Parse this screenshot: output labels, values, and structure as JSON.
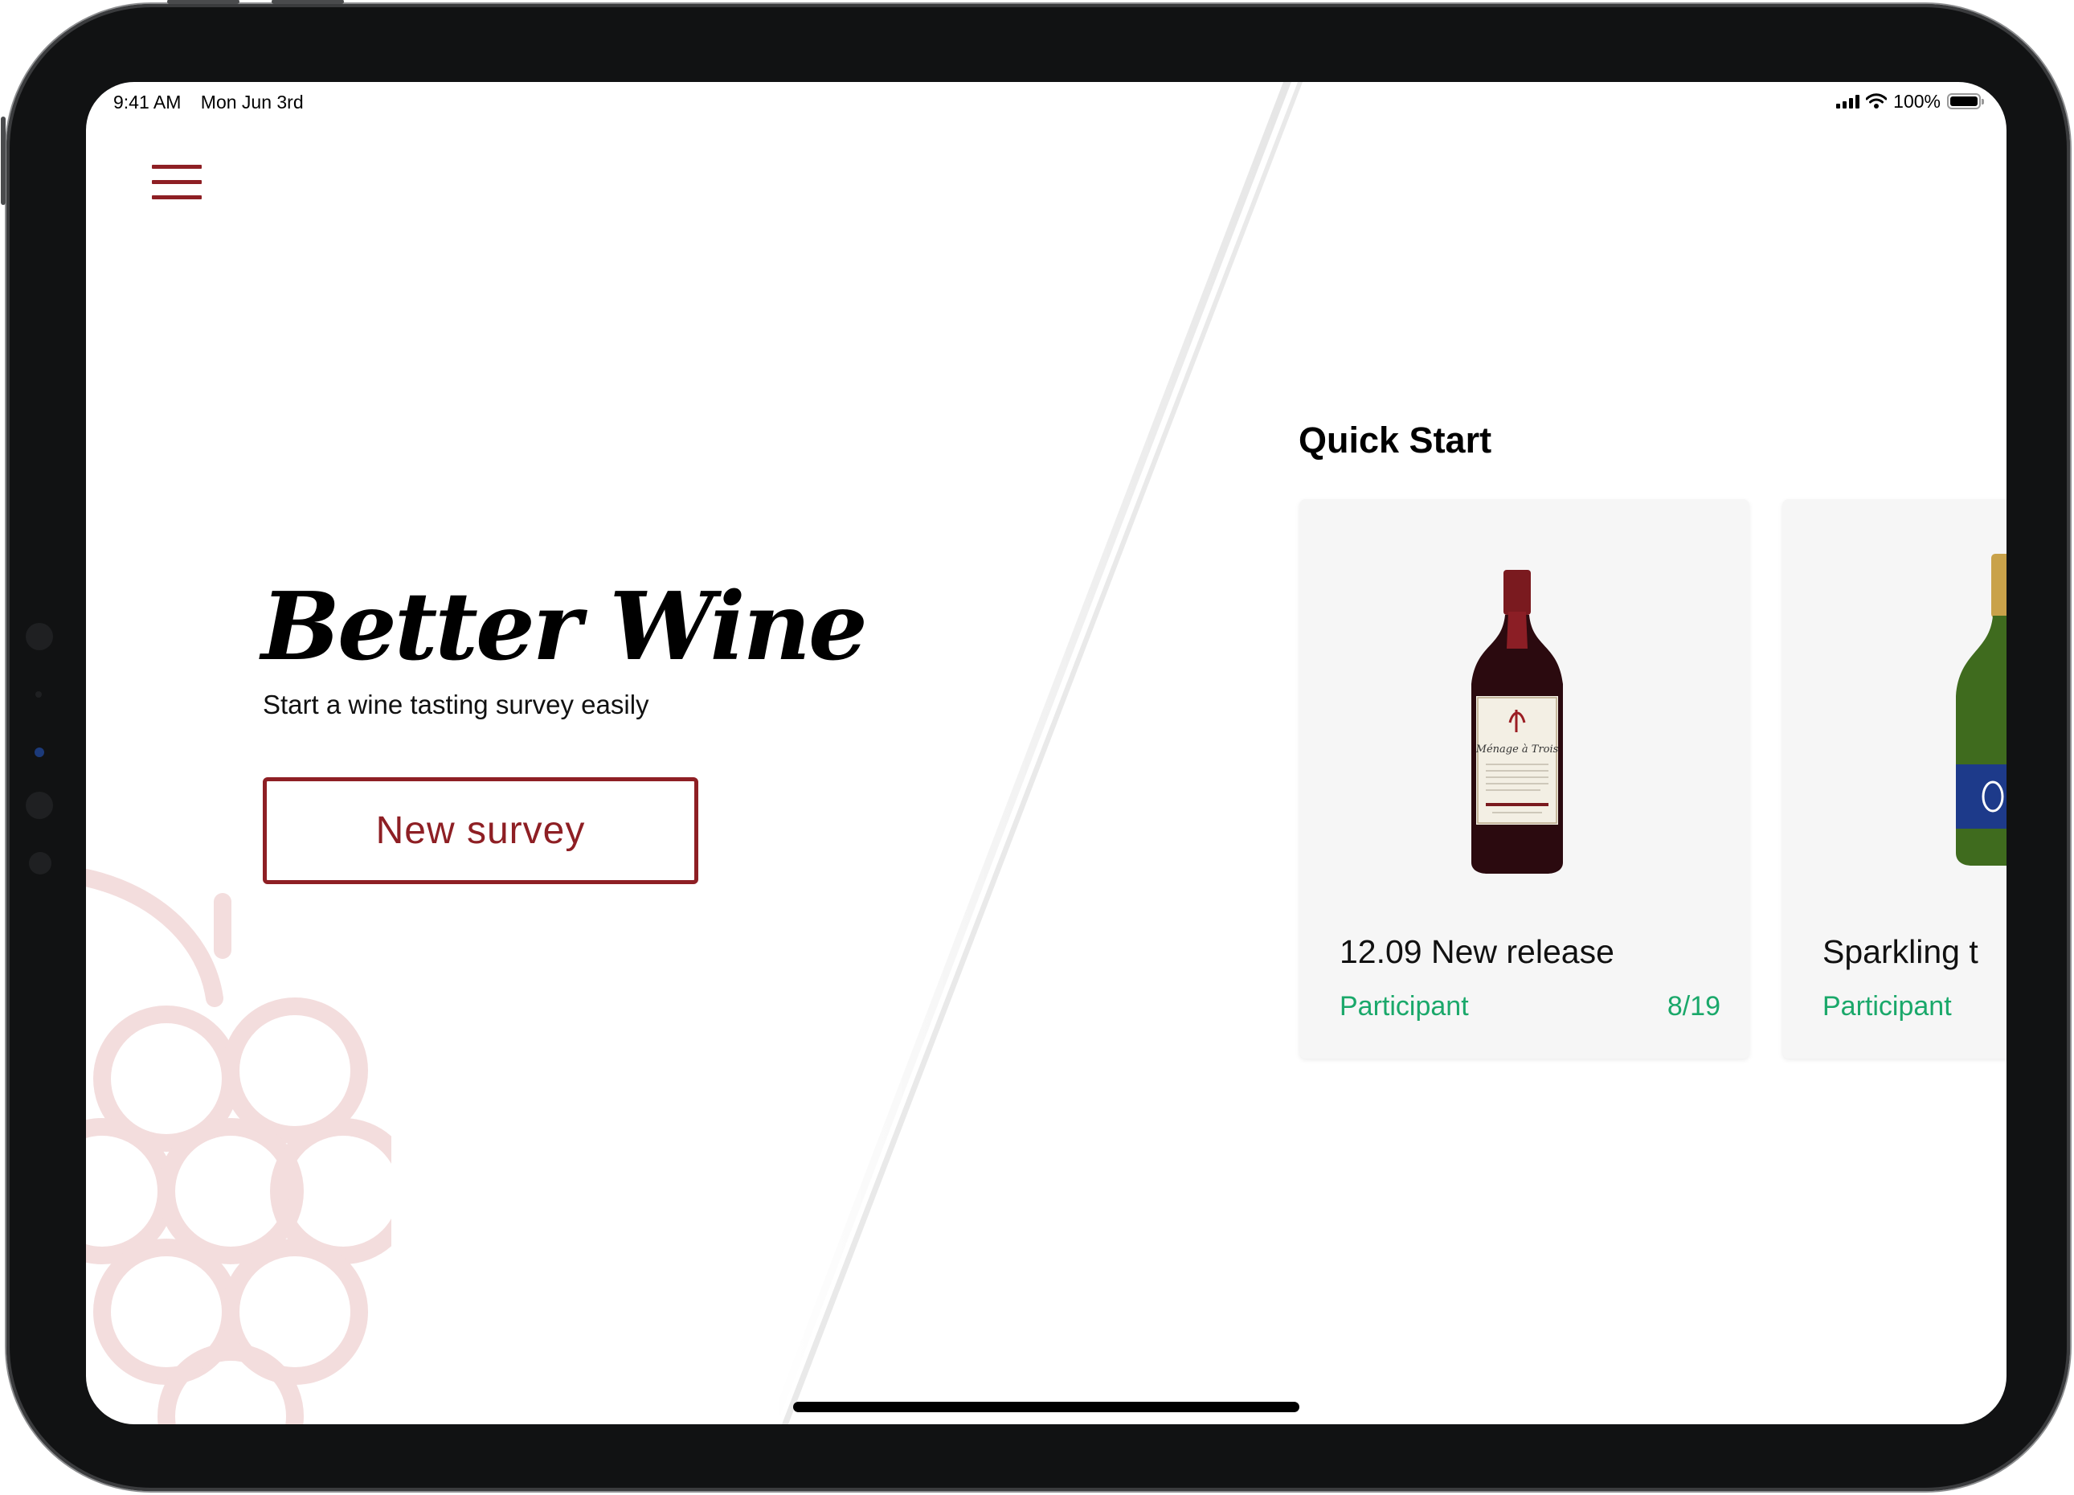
{
  "status_bar": {
    "time": "9:41 AM",
    "date": "Mon Jun 3rd",
    "battery": "100%",
    "icons": [
      "signal-icon",
      "wifi-icon",
      "battery-icon"
    ]
  },
  "menu": {
    "icon": "hamburger-menu-icon"
  },
  "hero": {
    "title": "Better Wine",
    "tagline": "Start a wine tasting survey easily",
    "button_label": "New survey",
    "decoration": "grape-icon"
  },
  "quick_start": {
    "heading": "Quick Start",
    "cards": [
      {
        "title": "12.09 New release",
        "role": "Participant",
        "count": "8/19",
        "image": "red-wine-bottle",
        "label_text": "Ménage à Trois"
      },
      {
        "title": "Sparkling t",
        "role": "Participant",
        "count": "",
        "image": "sparkling-wine-bottle"
      }
    ]
  },
  "colors": {
    "accent": "#8e1f24",
    "status_green": "#1aa86a",
    "card_bg": "#f6f6f6"
  }
}
